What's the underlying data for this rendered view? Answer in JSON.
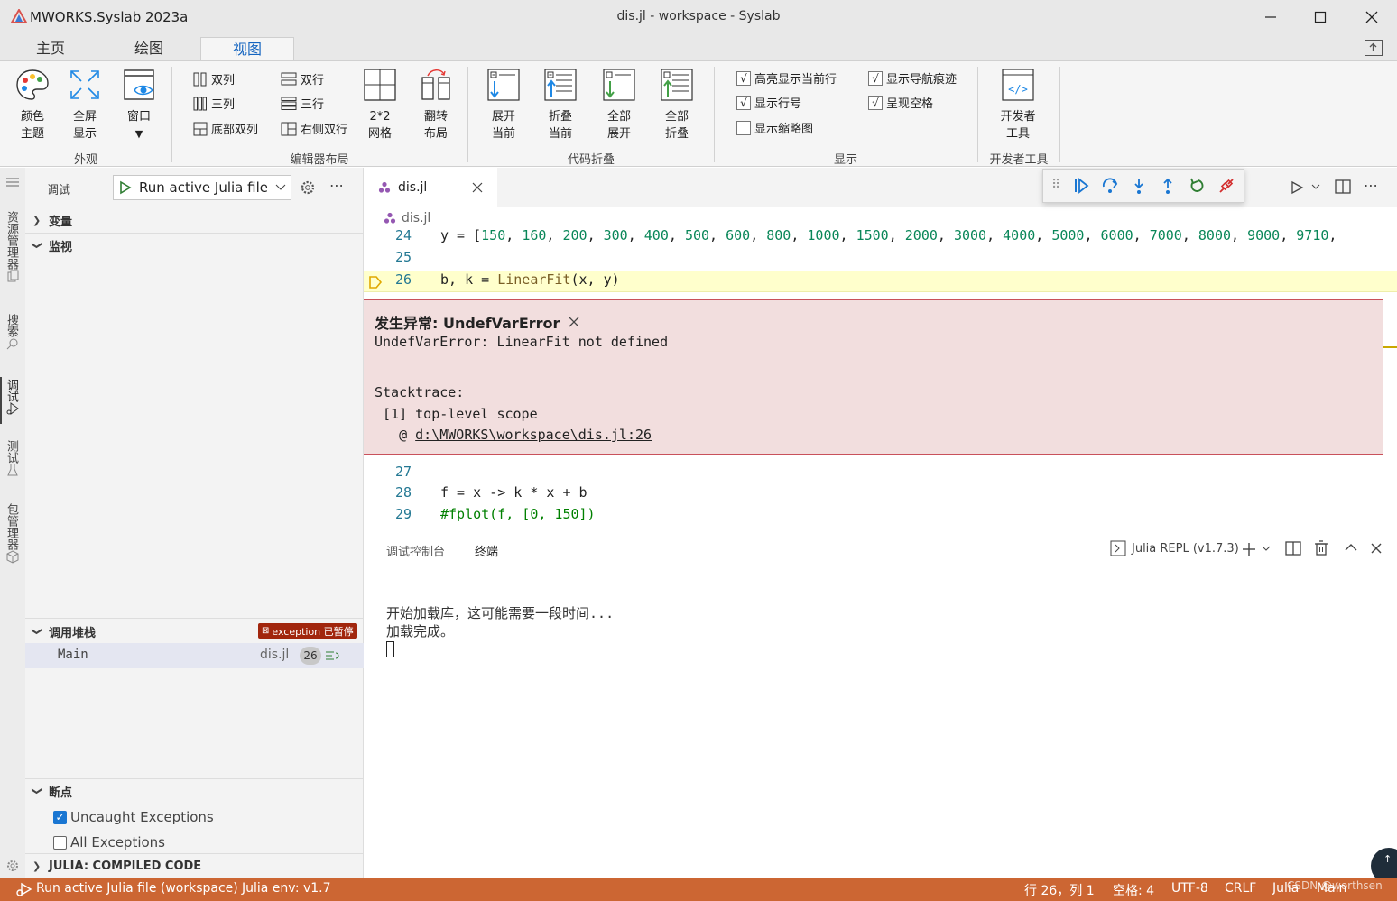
{
  "titlebar": {
    "app_title": "MWORKS.Syslab 2023a",
    "document_title": "dis.jl - workspace - Syslab"
  },
  "ribbon_tabs": [
    "主页",
    "绘图",
    "视图"
  ],
  "ribbon": {
    "appearance": {
      "color_theme": [
        "颜色",
        "主题"
      ],
      "fullscreen": [
        "全屏",
        "显示"
      ],
      "window": "窗口",
      "group_label": "外观"
    },
    "layout": {
      "two_cols": "双列",
      "three_cols": "三列",
      "bottom_two_cols": "底部双列",
      "two_rows": "双行",
      "three_rows": "三行",
      "side_two_rows": "右侧双行",
      "grid": [
        "2*2",
        "网格"
      ],
      "flip": [
        "翻转",
        "布局"
      ],
      "group_label": "编辑器布局"
    },
    "folding": {
      "expand_current": [
        "展开",
        "当前"
      ],
      "fold_current": [
        "折叠",
        "当前"
      ],
      "expand_all": [
        "全部",
        "展开"
      ],
      "fold_all": [
        "全部",
        "折叠"
      ],
      "group_label": "代码折叠"
    },
    "display": {
      "highlight_line": "高亮显示当前行",
      "show_line_numbers": "显示行号",
      "show_minimap": "显示缩略图",
      "show_nav_trace": "显示导航痕迹",
      "render_whitespace": "呈现空格",
      "group_label": "显示"
    },
    "dev": {
      "dev_tools": [
        "开发者",
        "工具"
      ],
      "group_label": "开发者工具"
    }
  },
  "activity": {
    "explorer": "资源管理器",
    "search": "搜索",
    "debug": "调试",
    "test": "测试",
    "packages": "包管理器"
  },
  "side": {
    "debug_label": "调试",
    "run_config": "Run active Julia file",
    "variables": "变量",
    "watch": "监视",
    "callstack": "调用堆栈",
    "exception_badge": "exception 已暂停",
    "frame_name": "Main",
    "frame_file": "dis.jl",
    "frame_line": "26",
    "breakpoints": "断点",
    "uncaught": "Uncaught Exceptions",
    "all_exceptions": "All Exceptions",
    "compiled": "JULIA: COMPILED CODE"
  },
  "editor": {
    "tab_name": "dis.jl",
    "breadcrumb": "dis.jl",
    "lines": [
      {
        "n": "24",
        "text": "y = [150, 160, 200, 300, 400, 500, 600, 800, 1000, 1500, 2000, 3000, 4000, 5000, 6000, 7000, 8000, 9000, 9710,"
      },
      {
        "n": "25",
        "text": ""
      },
      {
        "n": "26",
        "text": "b, k = LinearFit(x, y)"
      },
      {
        "n": "27",
        "text": ""
      },
      {
        "n": "28",
        "text": "f = x -> k * x + b"
      },
      {
        "n": "29",
        "text": "#fplot(f, [0, 150])"
      }
    ],
    "exception": {
      "title": "发生异常: UndefVarError",
      "message": "UndefVarError: LinearFit not defined",
      "stack_head": "Stacktrace:",
      "frame": " [1] top-level scope",
      "at": "   @ ",
      "link": "d:\\MWORKS\\workspace\\dis.jl:26"
    }
  },
  "panel": {
    "tab_debug_console": "调试控制台",
    "tab_terminal": "终端",
    "repl_name": "Julia REPL (v1.7.3)",
    "terminal_lines": [
      "开始加载库，这可能需要一段时间...",
      "加载完成。"
    ]
  },
  "status": {
    "run": "Run active Julia file (workspace)",
    "env": "Julia env: v1.7",
    "position": "行 26，列 1",
    "spaces": "空格: 4",
    "encoding": "UTF-8",
    "eol": "CRLF",
    "language": "Julia",
    "module": "Main",
    "watermark": "CSDN @worthsen"
  },
  "colors": {
    "accent": "#1565c0",
    "status_bar": "#cc6633",
    "exception_bg": "#f2dede",
    "current_line": "#ffffcc"
  }
}
